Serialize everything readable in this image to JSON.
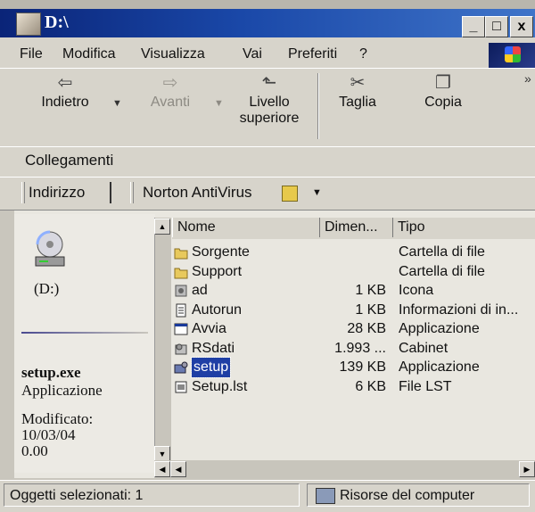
{
  "window": {
    "title": "D:\\",
    "minimize_label": "_",
    "maximize_label": "□",
    "close_label": "x"
  },
  "menu": {
    "items": [
      "File",
      "Modifica",
      "Visualizza",
      "Vai",
      "Preferiti",
      "?"
    ]
  },
  "toolbar": {
    "back_label": "Indietro",
    "forward_label": "Avanti",
    "up_label_line1": "Livello",
    "up_label_line2": "superiore",
    "cut_label": "Taglia",
    "copy_label": "Copia",
    "overflow_label": "»"
  },
  "links": {
    "label": "Collegamenti"
  },
  "address": {
    "label": "Indirizzo",
    "norton_label": "Norton AntiVirus"
  },
  "left_pane": {
    "drive_label": "(D:)",
    "selected_name": "setup.exe",
    "selected_type": "Applicazione",
    "modified_label": "Modificato:",
    "modified_date": "10/03/04",
    "modified_time": "0.00"
  },
  "file_list": {
    "columns": [
      "Nome",
      "Dimen...",
      "Tipo"
    ],
    "rows": [
      {
        "name": "Sorgente",
        "size": "",
        "type": "Cartella di file",
        "icon": "folder-icon"
      },
      {
        "name": "Support",
        "size": "",
        "type": "Cartella di file",
        "icon": "folder-icon"
      },
      {
        "name": "ad",
        "size": "1 KB",
        "type": "Icona",
        "icon": "icon-file-icon"
      },
      {
        "name": "Autorun",
        "size": "1 KB",
        "type": "Informazioni di in...",
        "icon": "setup-info-icon"
      },
      {
        "name": "Avvia",
        "size": "28 KB",
        "type": "Applicazione",
        "icon": "application-icon"
      },
      {
        "name": "RSdati",
        "size": "1.993 ...",
        "type": "Cabinet",
        "icon": "cabinet-icon"
      },
      {
        "name": "setup",
        "size": "139 KB",
        "type": "Applicazione",
        "icon": "setup-app-icon"
      },
      {
        "name": "Setup.lst",
        "size": "6 KB",
        "type": "File LST",
        "icon": "lst-file-icon"
      }
    ],
    "selected_index": 6
  },
  "status": {
    "left": "Oggetti selezionati: 1",
    "right": "Risorse del computer"
  },
  "colors": {
    "titlebar": "#0a2478",
    "selection": "#1f3fa5",
    "folder": "#e8c95c",
    "chrome": "#d7d4cb"
  }
}
